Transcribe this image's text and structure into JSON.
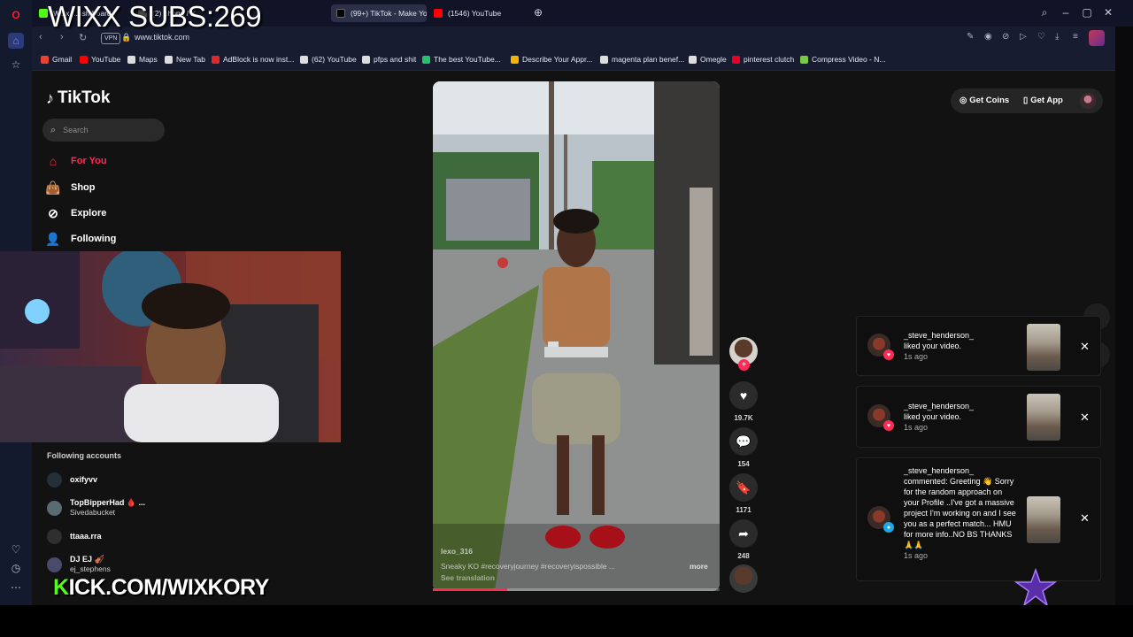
{
  "overlay": {
    "subs_text": "WIXX SUBS:269",
    "kick_text": "KICK.COM/WIXKORY",
    "kick_letter": "K",
    "kick_rest": "ICK.COM/WIXKORY"
  },
  "browser": {
    "tabs": [
      {
        "label": "Wixx ...ash board",
        "color": "#53fc18"
      },
      {
        "label": "(2) phone / X",
        "color": "#1d1d1d"
      },
      {
        "label": "(99+) TikTok - Make Yo",
        "color": "#000000"
      },
      {
        "label": "(1546) YouTube",
        "color": "#ff0000"
      }
    ],
    "url": "www.tiktok.com",
    "vpn_label": "VPN",
    "bookmarks": [
      "Gmail",
      "YouTube",
      "Maps",
      "New Tab",
      "AdBlock is now inst...",
      "(62) YouTube",
      "pfps and shit",
      "The best YouTube...",
      "Describe Your Appr...",
      "magenta plan benef...",
      "Omegle",
      "pinterest clutch",
      "Compress Video - N..."
    ]
  },
  "tiktok": {
    "logo": "TikTok",
    "search_placeholder": "Search",
    "nav": [
      {
        "label": "For You",
        "icon": "home-icon"
      },
      {
        "label": "Shop",
        "icon": "bag-icon"
      },
      {
        "label": "Explore",
        "icon": "compass-icon"
      },
      {
        "label": "Following",
        "icon": "user-icon"
      }
    ],
    "following_header": "Following accounts",
    "accounts": [
      {
        "name": "oxifyvv",
        "sub": ""
      },
      {
        "name": "TopBipperHad 🩸 ...",
        "sub": "Sivedabucket"
      },
      {
        "name": "ttaaa.rra",
        "sub": ""
      },
      {
        "name": "DJ EJ 🎻",
        "sub": "ej_stephens"
      }
    ],
    "top_buttons": {
      "coins": "Get Coins",
      "app": "Get App"
    },
    "video": {
      "username": "lexo_316",
      "description": "Sneaky KO #recoveryjourney #recoveryispossible ...",
      "more": "more",
      "see_translation": "See translation",
      "progress": 0.26,
      "likes": "19.7K",
      "comments": "154",
      "saves": "1171",
      "shares": "248"
    },
    "notifications": [
      {
        "user": "_steve_henderson_",
        "text": "liked your video.",
        "time": "1s ago",
        "badge_color": "#fe2c55",
        "badge_icon": "heart-icon"
      },
      {
        "user": "_steve_henderson_",
        "text": "liked your video.",
        "time": "1s ago",
        "badge_color": "#fe2c55",
        "badge_icon": "heart-icon"
      },
      {
        "user": "_steve_henderson_",
        "text": "commented: Greeting 👋 Sorry for the random approach on your Profile ..I've got a massive project I'm working on and I see you as a perfect match... HMU for more info..NO BS THANKS🙏🙏",
        "time": "1s ago",
        "badge_color": "#20a9e0",
        "badge_icon": "comment-icon"
      }
    ]
  },
  "colors": {
    "accent": "#fe2c55",
    "kick_green": "#53fc18"
  }
}
